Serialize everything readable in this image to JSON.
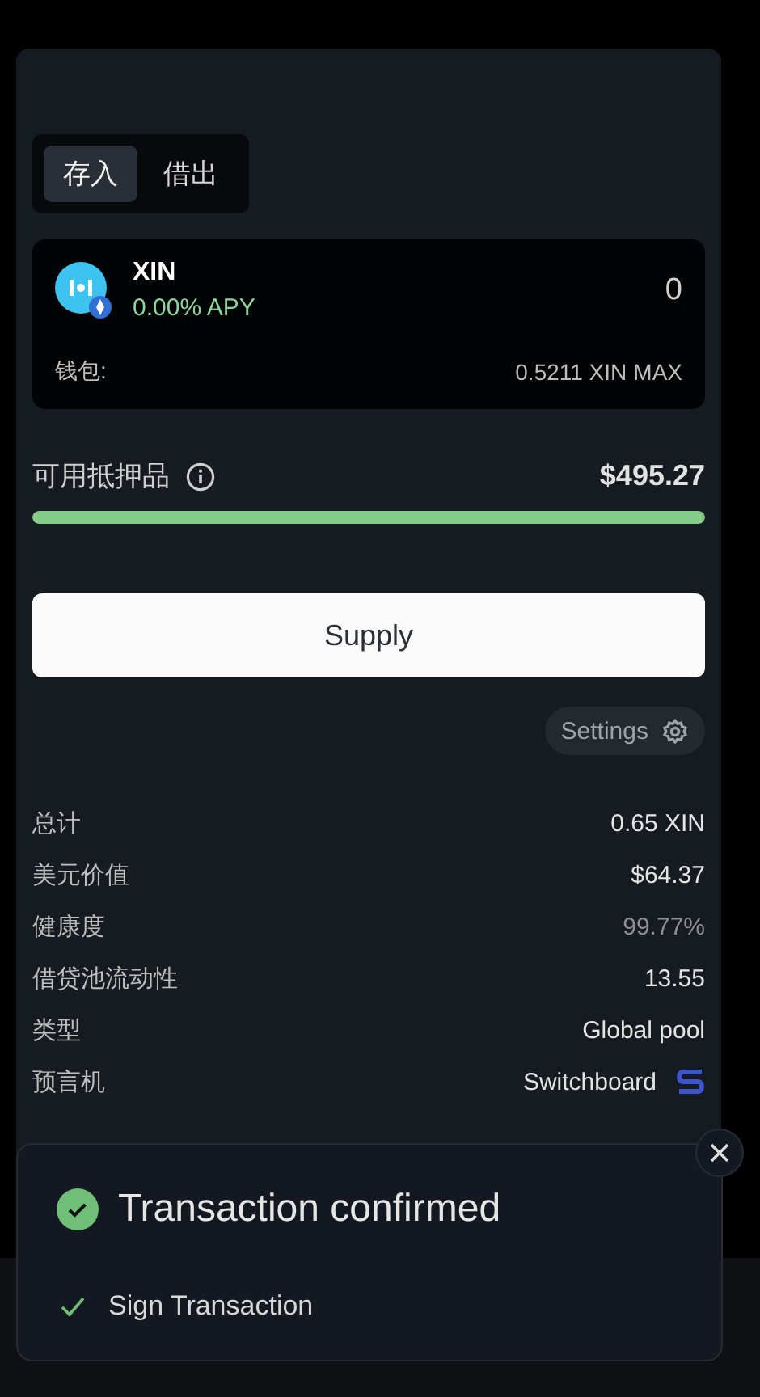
{
  "tabs": [
    {
      "label": "存入",
      "selected": true
    },
    {
      "label": "借出",
      "selected": false
    }
  ],
  "asset": {
    "symbol": "XIN",
    "apy": "0.00% APY",
    "amount": "0",
    "wallet_label": "钱包:",
    "wallet_value": "0.5211 XIN",
    "max": "MAX"
  },
  "collateral": {
    "label": "可用抵押品",
    "value": "$495.27",
    "level": 1
  },
  "supply_button": "Supply",
  "settings_button": "Settings",
  "details": [
    {
      "label": "总计",
      "value": "0.65 XIN",
      "kind": "text"
    },
    {
      "label": "美元价值",
      "value": "$64.37",
      "kind": "text"
    },
    {
      "label": "健康度",
      "value": "99.77%",
      "kind": "muted"
    },
    {
      "label": "借贷池流动性",
      "value": "13.55",
      "kind": "text"
    },
    {
      "label": "类型",
      "value": "Global pool",
      "kind": "text"
    },
    {
      "label": "预言机",
      "value": "Switchboard",
      "kind": "oracle"
    }
  ],
  "toast": {
    "title": "Transaction confirmed",
    "steps": [
      {
        "label": "Sign Transaction",
        "done": true
      }
    ]
  }
}
